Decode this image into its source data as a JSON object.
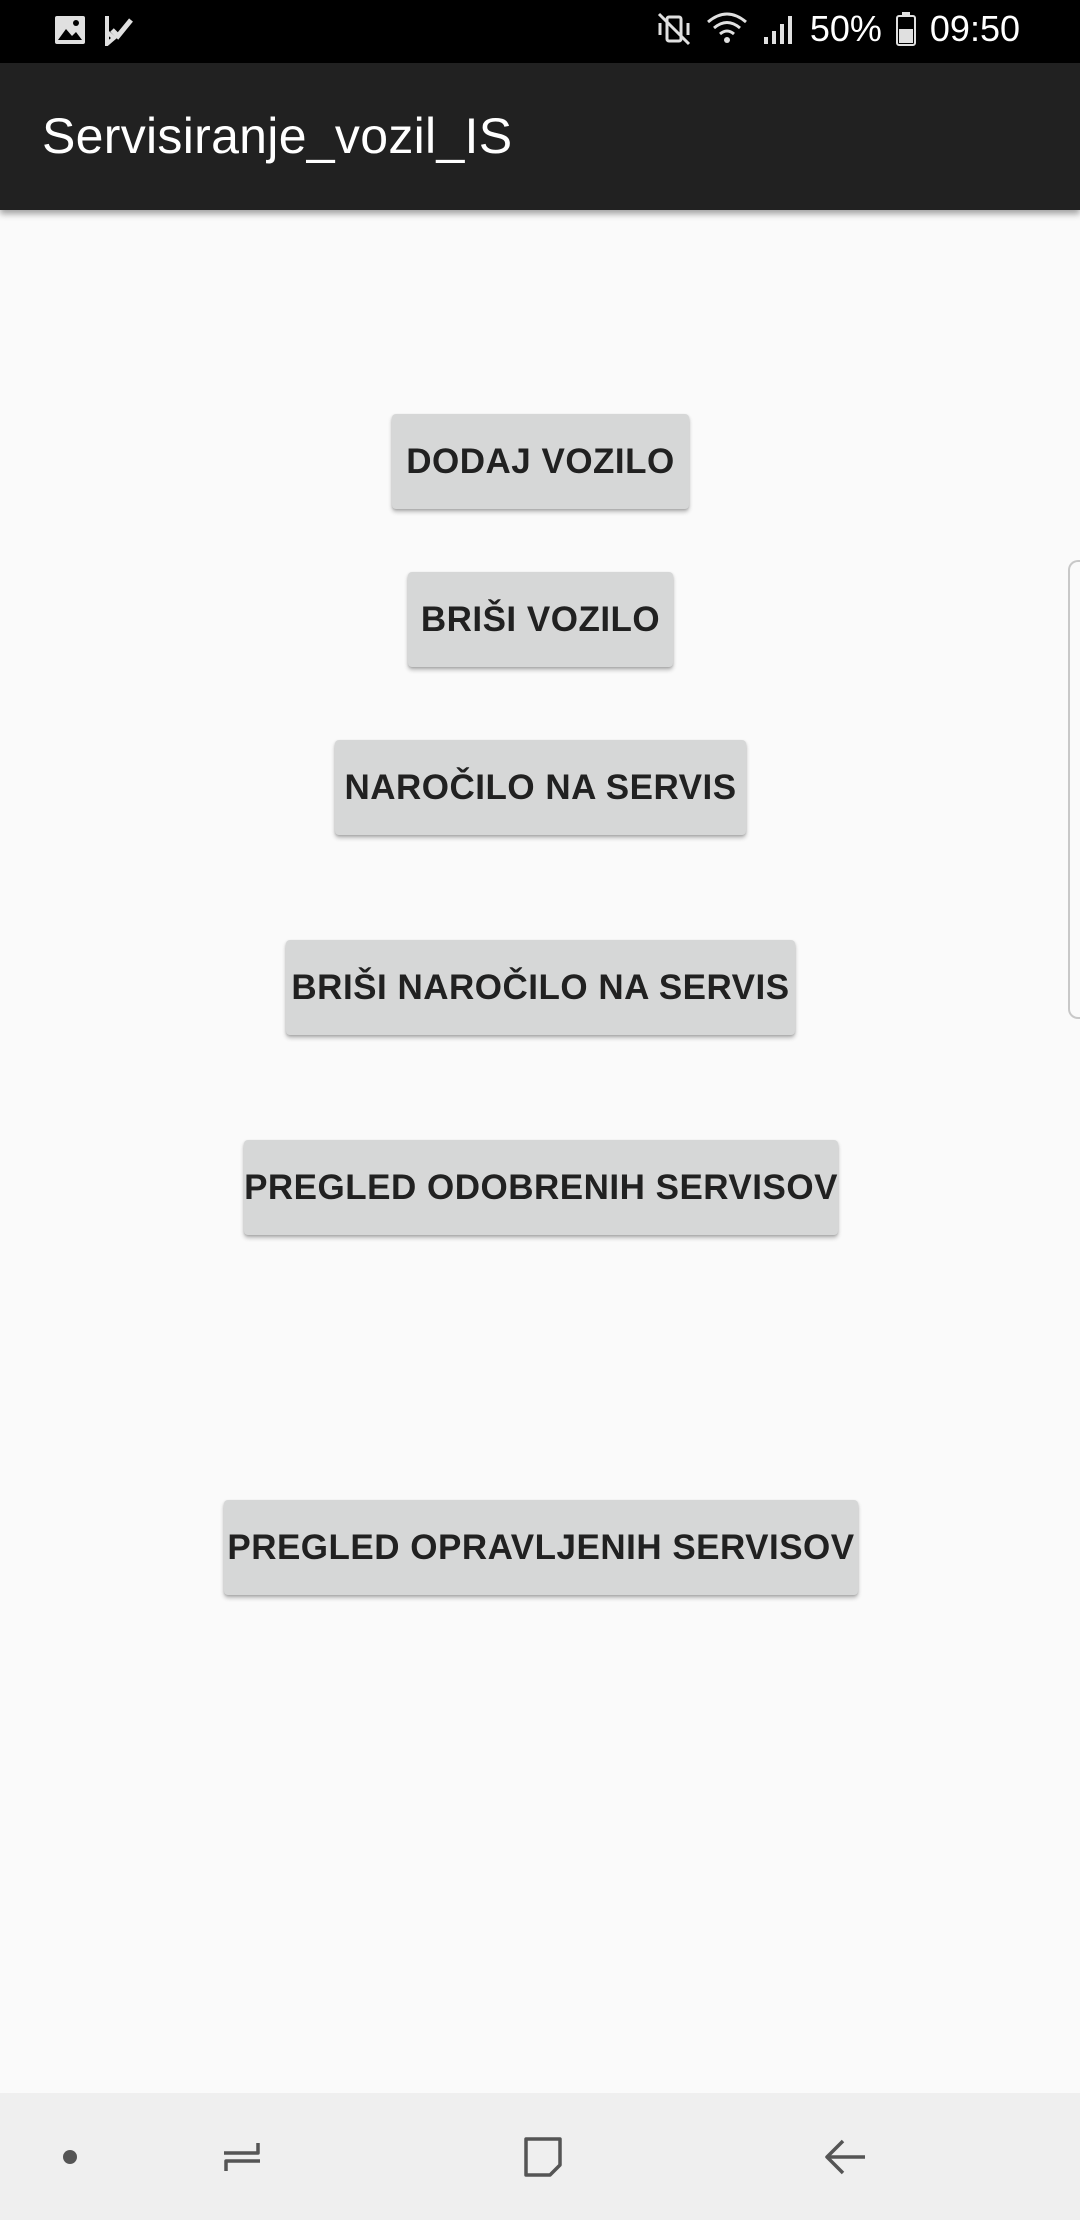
{
  "status_bar": {
    "left_icons": [
      "image-notification-icon",
      "checkmark-notification-icon"
    ],
    "right_icons": [
      "mute-vibrate-icon",
      "wifi-icon",
      "signal-icon",
      "battery-icon"
    ],
    "battery": "50%",
    "time": "09:50"
  },
  "app_bar": {
    "title": "Servisiranje_vozil_IS"
  },
  "buttons": {
    "add_vehicle": "DODAJ VOZILO",
    "delete_vehicle": "BRIŠI VOZILO",
    "service_order": "NAROČILO NA SERVIS",
    "delete_service_order": "BRIŠI NAROČILO NA SERVIS",
    "approved_services": "PREGLED ODOBRENIH SERVISOV",
    "completed_services": "PREGLED OPRAVLJENIH SERVISOV"
  },
  "nav_bar": {
    "icons": [
      "dot-icon",
      "recent-apps-icon",
      "home-icon",
      "back-icon"
    ]
  },
  "colors": {
    "status_bar": "#000000",
    "app_bar": "#212121",
    "background": "#fafafa",
    "button": "#d6d7d7",
    "nav_bar": "#efefef"
  }
}
